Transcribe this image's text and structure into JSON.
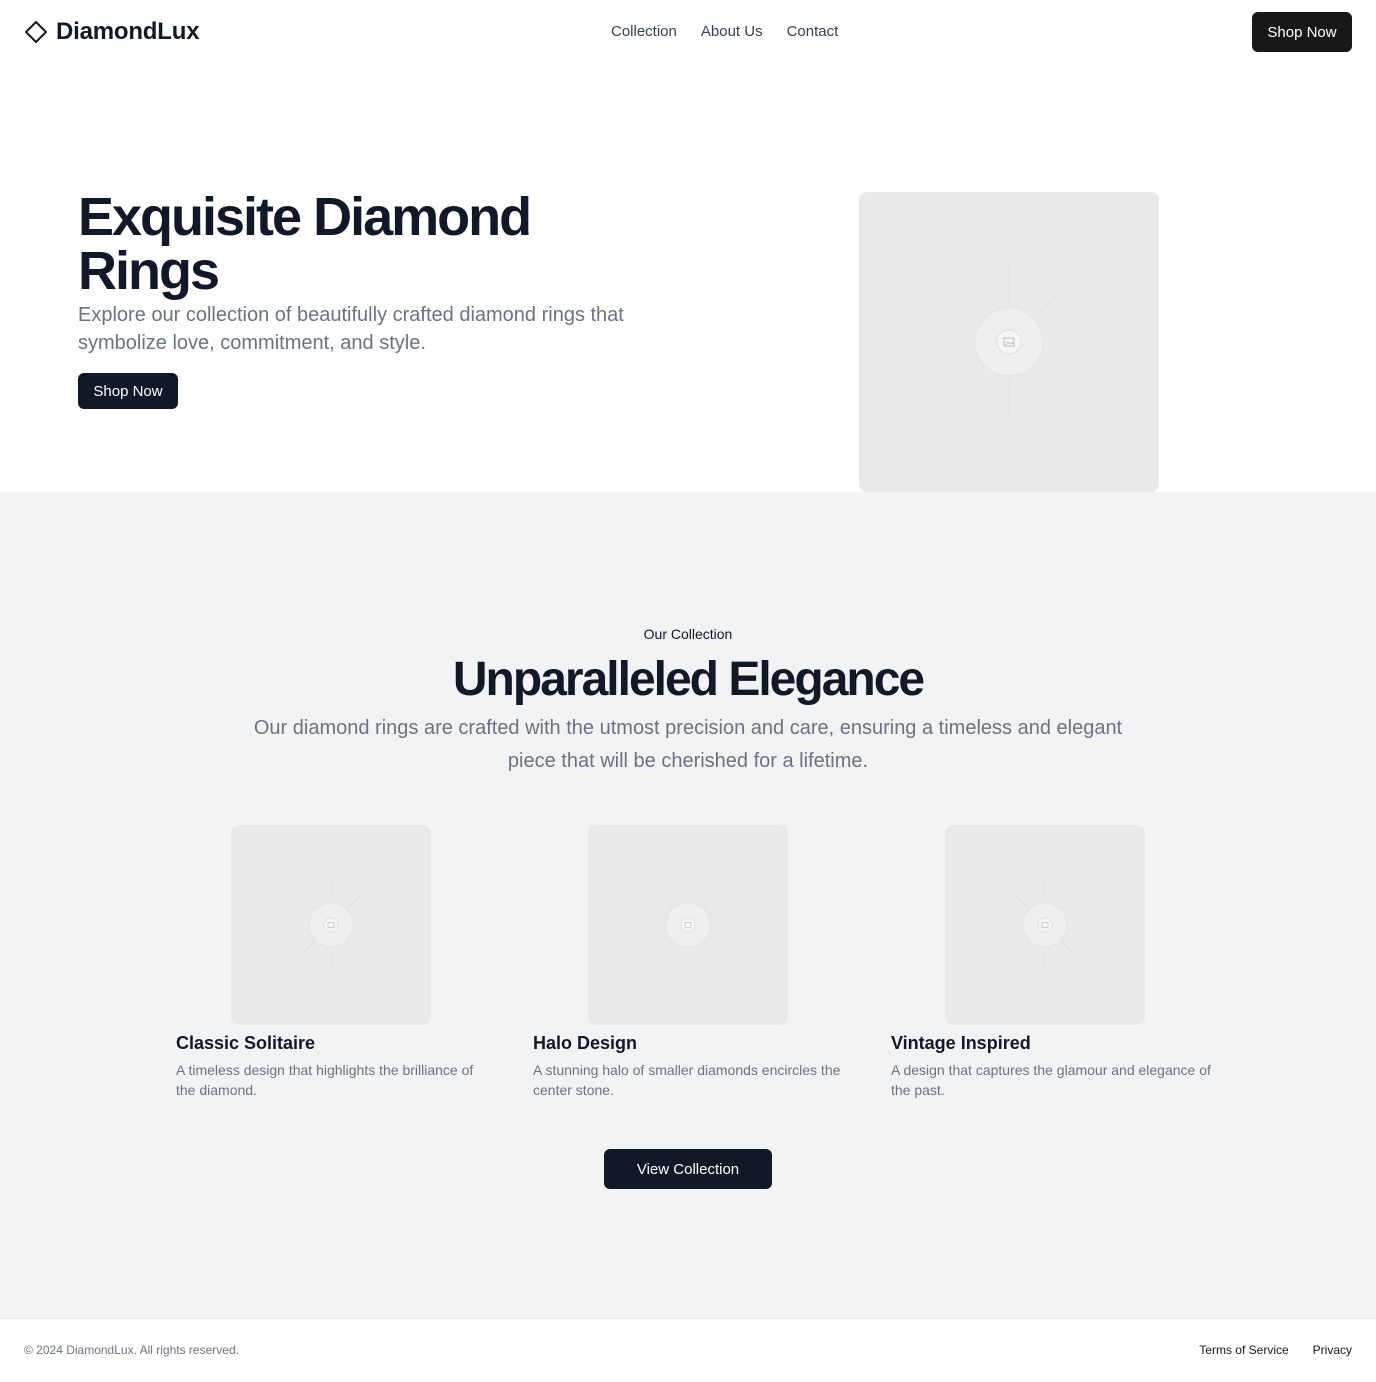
{
  "header": {
    "brand_name": "DiamondLux",
    "brand_icon": "diamond-icon",
    "nav": [
      {
        "label": "Collection"
      },
      {
        "label": "About Us"
      },
      {
        "label": "Contact"
      }
    ],
    "cta_label": "Shop Now"
  },
  "hero": {
    "title": "Exquisite Diamond Rings",
    "subtitle": "Explore our collection of beautifully crafted diamond rings that symbolize love, commitment, and style.",
    "cta_label": "Shop Now",
    "image_icon": "image-placeholder-icon"
  },
  "collection": {
    "eyebrow": "Our Collection",
    "title": "Unparalleled Elegance",
    "subtitle": "Our diamond rings are crafted with the utmost precision and care, ensuring a timeless and elegant piece that will be cherished for a lifetime.",
    "cards": [
      {
        "title": "Classic Solitaire",
        "description": "A timeless design that highlights the brilliance of the diamond."
      },
      {
        "title": "Halo Design",
        "description": "A stunning halo of smaller diamonds encircles the center stone."
      },
      {
        "title": "Vintage Inspired",
        "description": "A design that captures the glamour and elegance of the past."
      }
    ],
    "view_label": "View Collection"
  },
  "footer": {
    "copyright": "© 2024 DiamondLux. All rights reserved.",
    "links": [
      {
        "label": "Terms of Service"
      },
      {
        "label": "Privacy"
      }
    ]
  },
  "colors": {
    "primary": "#111827",
    "muted_text": "#6b7280",
    "section_bg": "#f2f3f5",
    "placeholder_bg": "#e9e9e9"
  }
}
